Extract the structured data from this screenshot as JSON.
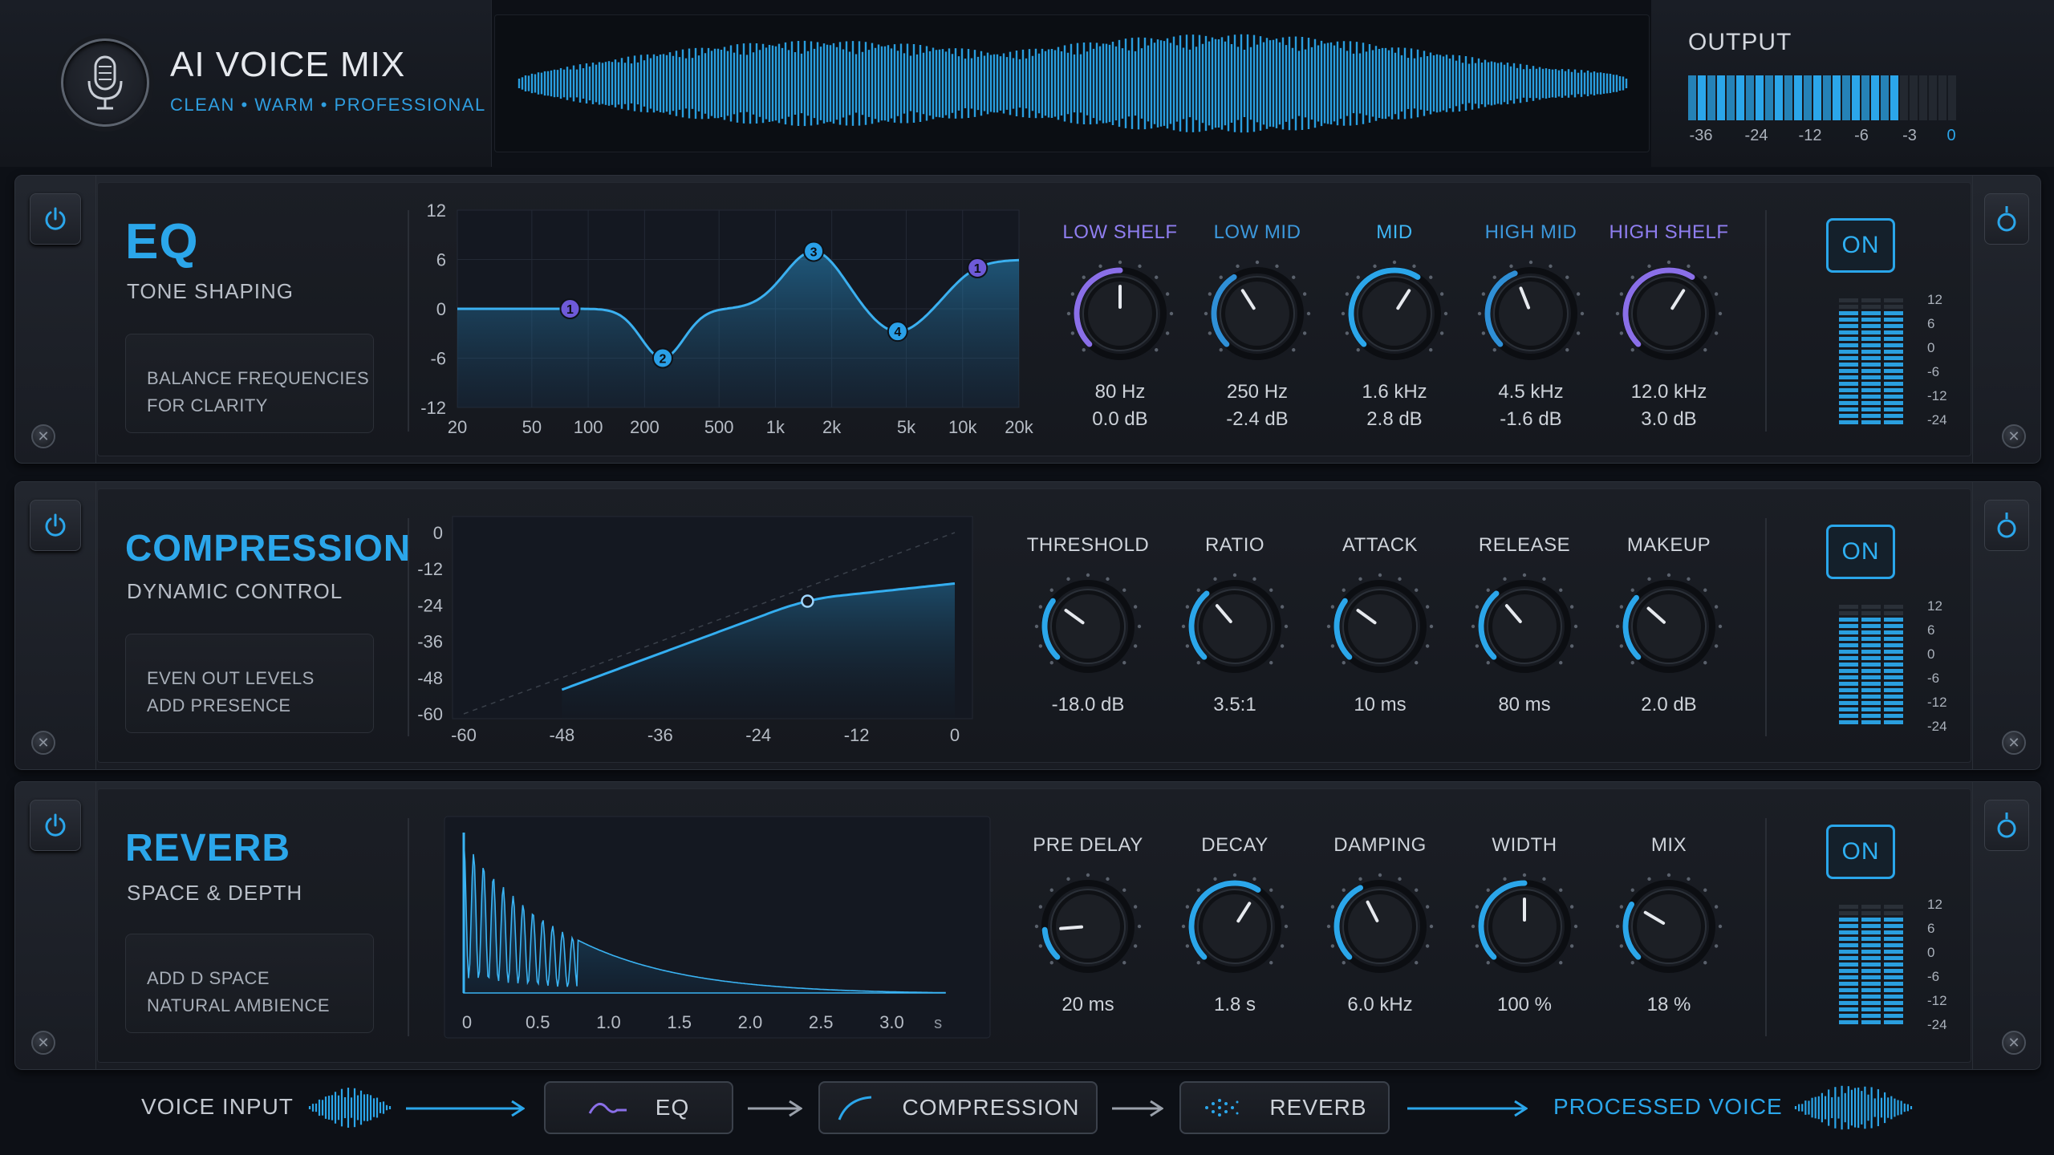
{
  "app": {
    "title": "AI VOICE MIX",
    "tagline": "CLEAN • WARM • PROFESSIONAL",
    "output_label": "OUTPUT",
    "output_scale": [
      "-36",
      "-24",
      "-12",
      "-6",
      "-3",
      "0"
    ],
    "output_level": 0.78
  },
  "colors": {
    "accent": "#2ba6ea",
    "purple": "#8a6fe8",
    "panel": "#1b1e25"
  },
  "eq": {
    "title": "EQ",
    "subtitle": "TONE SHAPING",
    "description": [
      "BALANCE FREQUENCIES",
      "FOR CLARITY"
    ],
    "y_ticks": [
      "12",
      "6",
      "0",
      "-6",
      "-12"
    ],
    "x_ticks": [
      "20",
      "50",
      "100",
      "200",
      "500",
      "1k",
      "2k",
      "5k",
      "10k",
      "20k"
    ],
    "nodes": [
      {
        "label": "1",
        "freq_hz": 80,
        "gain_db": 0.0
      },
      {
        "label": "2",
        "freq_hz": 250,
        "gain_db": -6.0
      },
      {
        "label": "3",
        "freq_hz": 1600,
        "gain_db": 7.0
      },
      {
        "label": "4",
        "freq_hz": 4500,
        "gain_db": -3.0
      },
      {
        "label": "1",
        "freq_hz": 12000,
        "gain_db": 6.0
      }
    ],
    "knobs": [
      {
        "label": "LOW SHELF",
        "freq": "80 Hz",
        "gain": "0.0 dB",
        "value": 0.5,
        "color": "#8a6fe8"
      },
      {
        "label": "LOW MID",
        "freq": "250 Hz",
        "gain": "-2.4 dB",
        "value": 0.38,
        "color": "#2f8fd6"
      },
      {
        "label": "MID",
        "freq": "1.6 kHz",
        "gain": "2.8 dB",
        "value": 0.62,
        "color": "#2ba6ea"
      },
      {
        "label": "HIGH MID",
        "freq": "4.5 kHz",
        "gain": "-1.6 dB",
        "value": 0.42,
        "color": "#2f8fd6"
      },
      {
        "label": "HIGH SHELF",
        "freq": "12.0 kHz",
        "gain": "3.0 dB",
        "value": 0.62,
        "color": "#8a6fe8"
      }
    ],
    "power": "ON",
    "meter_scale": [
      "12",
      "6",
      "0",
      "-6",
      "-12",
      "-24"
    ]
  },
  "compression": {
    "title": "COMPRESSION",
    "subtitle": "DYNAMIC CONTROL",
    "description": [
      "EVEN OUT LEVELS",
      "ADD PRESENCE"
    ],
    "y_ticks": [
      "0",
      "-12",
      "-24",
      "-36",
      "-48",
      "-60"
    ],
    "x_ticks": [
      "-60",
      "-48",
      "-36",
      "-24",
      "-12",
      "0"
    ],
    "threshold_db": -18,
    "ratio": 3.5,
    "knobs": [
      {
        "label": "THRESHOLD",
        "value_text": "-18.0 dB",
        "value": 0.3
      },
      {
        "label": "RATIO",
        "value_text": "3.5:1",
        "value": 0.35
      },
      {
        "label": "ATTACK",
        "value_text": "10 ms",
        "value": 0.3
      },
      {
        "label": "RELEASE",
        "value_text": "80 ms",
        "value": 0.35
      },
      {
        "label": "MAKEUP",
        "value_text": "2.0 dB",
        "value": 0.32
      }
    ],
    "power": "ON",
    "meter_scale": [
      "12",
      "6",
      "0",
      "-6",
      "-12",
      "-24"
    ]
  },
  "reverb": {
    "title": "REVERB",
    "subtitle": "SPACE & DEPTH",
    "description": [
      "ADD D SPACE",
      "NATURAL AMBIENCE"
    ],
    "x_ticks": [
      "0",
      "0.5",
      "1.0",
      "1.5",
      "2.0",
      "2.5",
      "3.0",
      "s"
    ],
    "decay_s": 3.4,
    "knobs": [
      {
        "label": "PRE DELAY",
        "value_text": "20 ms",
        "value": 0.15
      },
      {
        "label": "DECAY",
        "value_text": "1.8 s",
        "value": 0.62
      },
      {
        "label": "DAMPING",
        "value_text": "6.0 kHz",
        "value": 0.4
      },
      {
        "label": "WIDTH",
        "value_text": "100 %",
        "value": 0.5
      },
      {
        "label": "MIX",
        "value_text": "18 %",
        "value": 0.28
      }
    ],
    "power": "ON",
    "meter_scale": [
      "12",
      "6",
      "0",
      "-6",
      "-12",
      "-24"
    ]
  },
  "chain": {
    "input": "VOICE INPUT",
    "steps": [
      "EQ",
      "COMPRESSION",
      "REVERB"
    ],
    "output": "PROCESSED VOICE"
  }
}
